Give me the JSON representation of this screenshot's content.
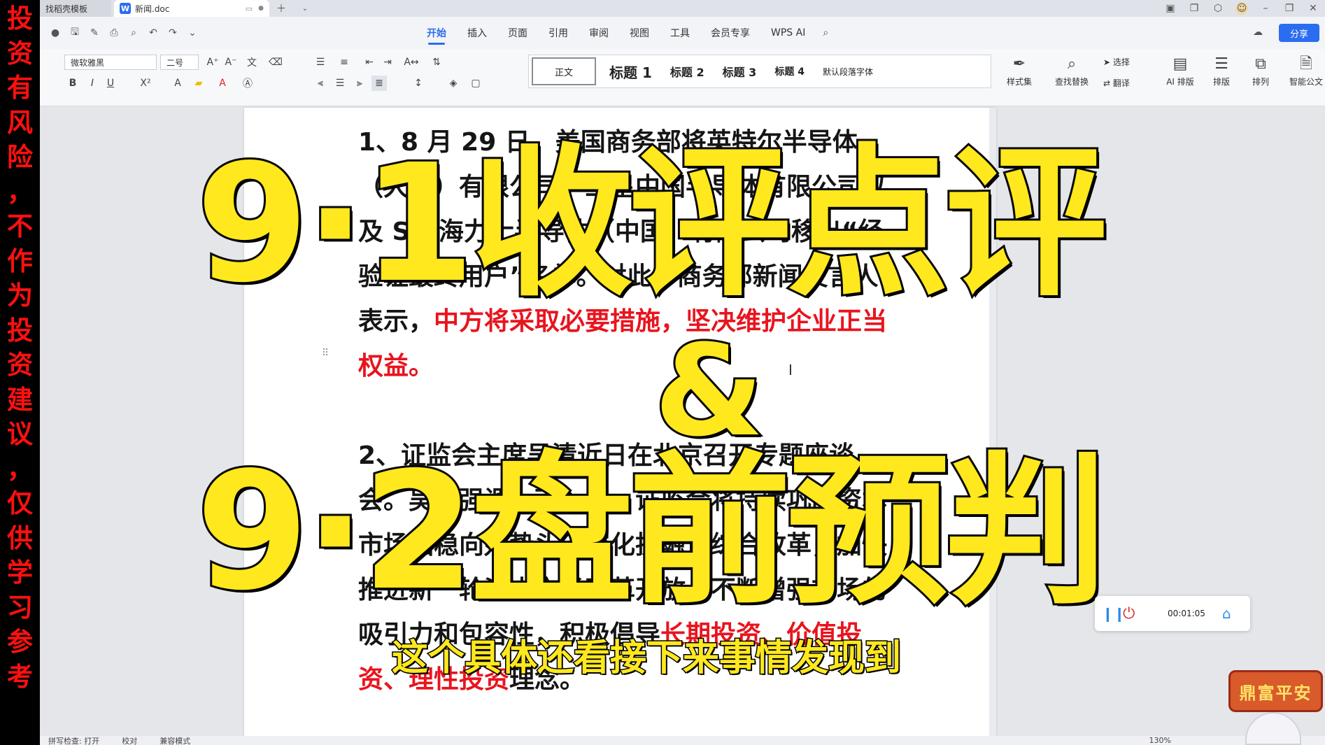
{
  "warning": [
    "投",
    "资",
    "有",
    "风",
    "险",
    "，",
    "不",
    "作",
    "为",
    "投",
    "资",
    "建",
    "议",
    "，",
    "仅",
    "供",
    "学",
    "习",
    "参",
    "考"
  ],
  "tabs": {
    "template": "找稻壳模板",
    "doc": "新闻.doc",
    "doc_badge": "W"
  },
  "menu": {
    "tabs": [
      "开始",
      "插入",
      "页面",
      "引用",
      "审阅",
      "视图",
      "工具",
      "会员专享",
      "WPS AI"
    ],
    "share": "分享"
  },
  "ribbon": {
    "font_name": "微软雅黑",
    "font_size": "二号",
    "styles": [
      "正文",
      "标题 1",
      "标题 2",
      "标题 3",
      "标题 4",
      "默认段落字体"
    ],
    "tools": [
      "样式集",
      "查找替换",
      "选择",
      "翻译",
      "AI 排版",
      "排版",
      "排列",
      "智能公文"
    ]
  },
  "doc": {
    "p1_black1": "1、8 月 29 日，美国商务部将英特尔半导体（大连）有限公司、三星中国半导体有限公司以及 SK 海力士半导体（中国）有限公司移出“经验证最终用户”名单。对此，商务部新闻发言人表示，",
    "p1_red": "中方将采取必要措施，坚决维护企业正当权益。",
    "p2_black1": "2、证监会主席吴清近日在北京召开专题座谈会。吴清强调，下一步，证监会将持续巩固资本市场回稳向好势头，深化投融资综合改革，加快推进新一轮资本市场改革开放，不断增强市场的吸引力和包容性，积极倡导",
    "p2_red": "长期投资、价值投资、理性投资",
    "p2_black2": "理念。"
  },
  "overlay": {
    "line1": "9·1收评点评",
    "amp": "&",
    "line2": "9·2盘前预判",
    "subtitle": "这个具体还看接下来事情发现到"
  },
  "recorder": {
    "time": "00:01:05"
  },
  "badge": "鼎富平安",
  "status": {
    "spellcheck": "拼写检查: 打开",
    "proof": "校对",
    "compat": "兼容模式",
    "zoom": "130%"
  }
}
